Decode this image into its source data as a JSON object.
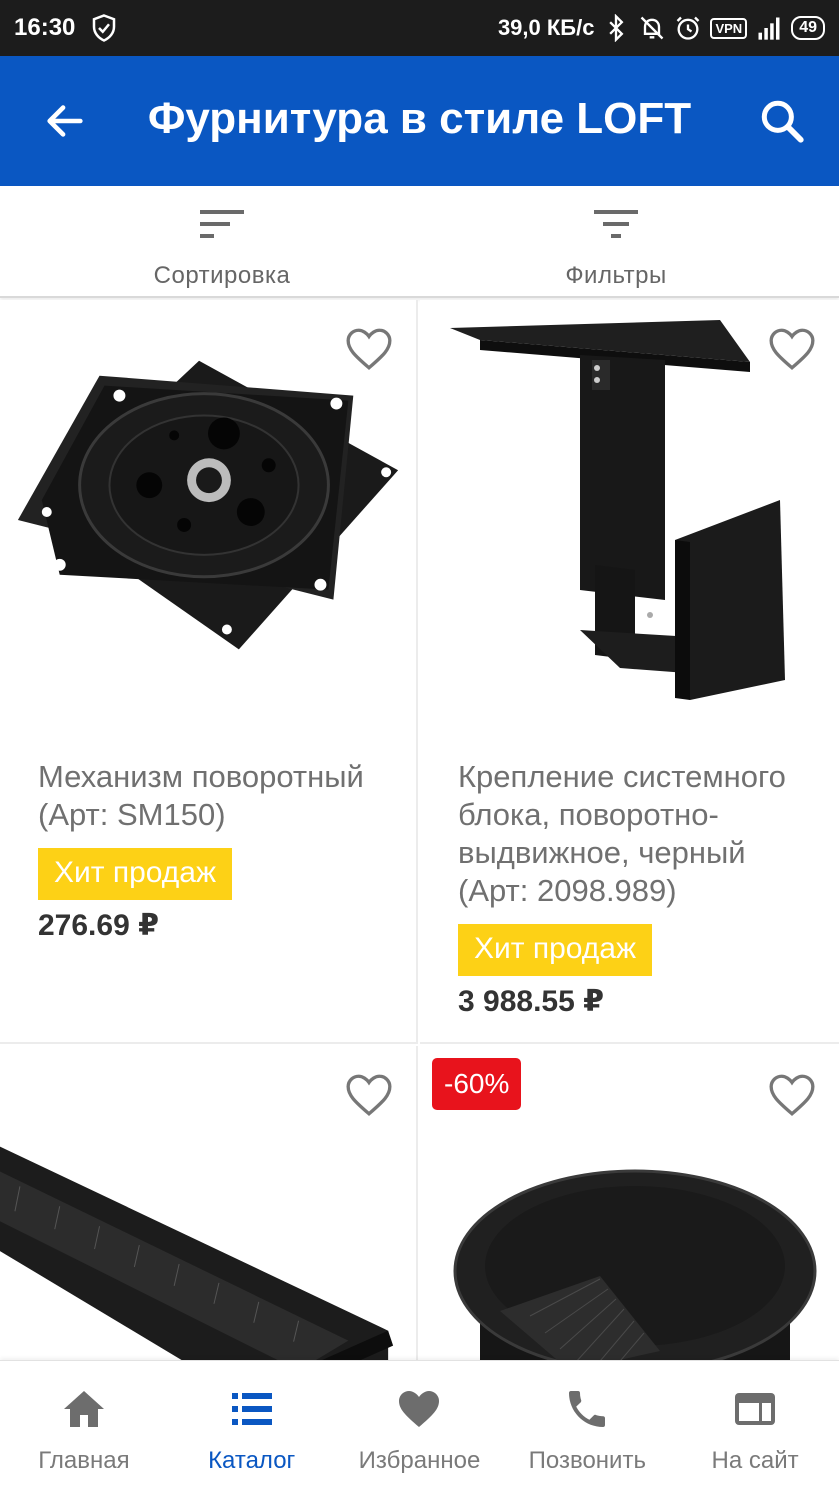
{
  "status_bar": {
    "time": "16:30",
    "speed": "39,0 КБ/с",
    "vpn": "VPN",
    "battery": "49",
    "icons": [
      "shield-check-icon",
      "bluetooth-icon",
      "bell-off-icon",
      "alarm-icon",
      "vpn-icon",
      "signal-icon",
      "battery-icon"
    ]
  },
  "appbar": {
    "title": "Фурнитура в стиле LOFT",
    "color": "#0a57c2"
  },
  "toolbar": {
    "sort_label": "Сортировка",
    "filter_label": "Фильтры"
  },
  "products": [
    {
      "name": "Механизм поворотный (Арт: SM150)",
      "badge": "Хит продаж",
      "price": "276.69 ₽"
    },
    {
      "name": "Крепление системного блока, поворотно-выдвижное, черный (Арт: 2098.989)",
      "badge": "Хит продаж",
      "price": "3 988.55 ₽"
    },
    {
      "name": "",
      "badge": "",
      "price": ""
    },
    {
      "name": "",
      "discount": "-60%",
      "price": ""
    }
  ],
  "bottom_nav": [
    {
      "label": "Главная",
      "icon": "home-icon",
      "active": false
    },
    {
      "label": "Каталог",
      "icon": "list-icon",
      "active": true
    },
    {
      "label": "Избранное",
      "icon": "heart-icon",
      "active": false
    },
    {
      "label": "Позвонить",
      "icon": "phone-icon",
      "active": false
    },
    {
      "label": "На сайт",
      "icon": "browser-icon",
      "active": false
    }
  ],
  "colors": {
    "accent": "#0a57c2",
    "badge": "#fdd116",
    "discount": "#e8131c"
  }
}
